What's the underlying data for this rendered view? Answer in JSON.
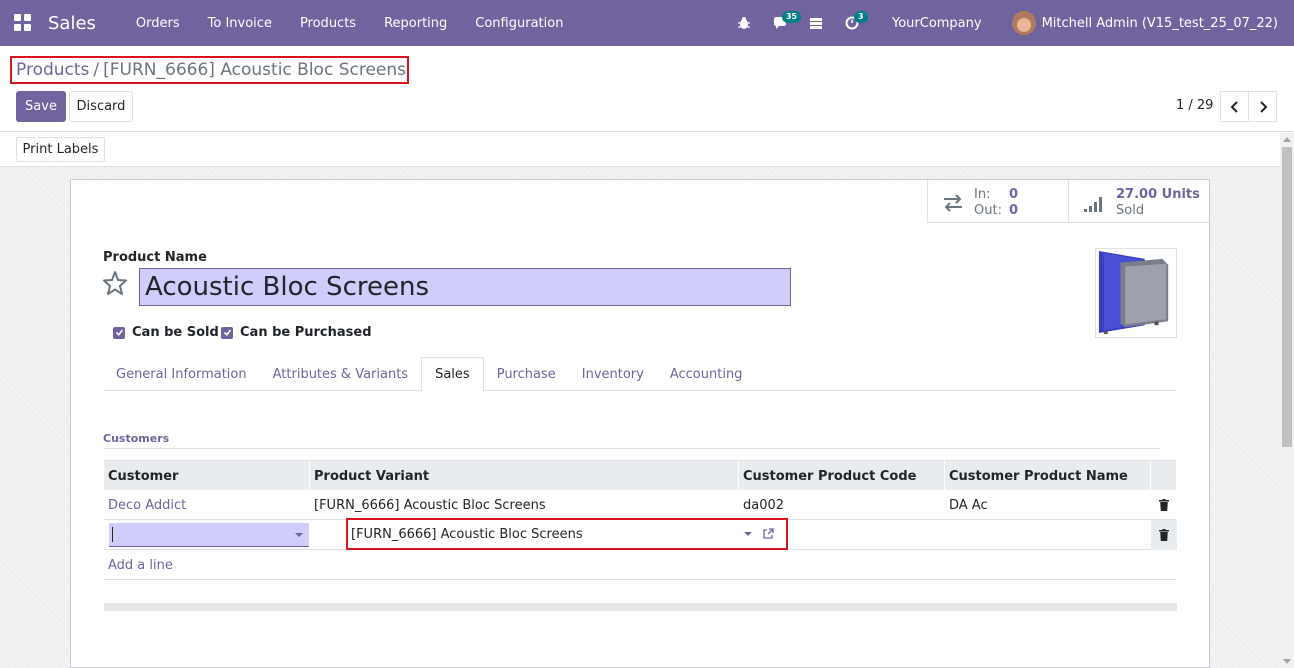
{
  "navbar": {
    "app_name": "Sales",
    "menu": [
      "Orders",
      "To Invoice",
      "Products",
      "Reporting",
      "Configuration"
    ],
    "messages_badge": "35",
    "activities_badge": "3",
    "company": "YourCompany",
    "user": "Mitchell Admin (V15_test_25_07_22)",
    "bg_color": "#71639e"
  },
  "breadcrumb": {
    "parent": "Products",
    "separator": "/",
    "current": "[FURN_6666] Acoustic Bloc Screens"
  },
  "buttons": {
    "save": "Save",
    "discard": "Discard",
    "print_labels": "Print Labels"
  },
  "pager": {
    "value": "1 / 29"
  },
  "smart_buttons": {
    "in_label": "In:",
    "in_value": "0",
    "out_label": "Out:",
    "out_value": "0",
    "sold_value": "27.00 Units",
    "sold_label": "Sold"
  },
  "form": {
    "product_name_label": "Product Name",
    "product_name": "Acoustic Bloc Screens",
    "can_be_sold": "Can be Sold",
    "can_be_purchased": "Can be Purchased"
  },
  "tabs": [
    "General Information",
    "Attributes & Variants",
    "Sales",
    "Purchase",
    "Inventory",
    "Accounting"
  ],
  "active_tab": "Sales",
  "customers": {
    "section_title": "Customers",
    "columns": [
      "Customer",
      "Product Variant",
      "Customer Product Code",
      "Customer Product Name"
    ],
    "rows": [
      {
        "customer": "Deco Addict",
        "variant": "[FURN_6666] Acoustic Bloc Screens",
        "code": "da002",
        "name": "DA Ac"
      }
    ],
    "editing_row": {
      "customer": "",
      "variant": "[FURN_6666] Acoustic Bloc Screens",
      "code": "",
      "name": ""
    },
    "add_line": "Add a line"
  },
  "colors": {
    "accent": "#71639e",
    "highlight_box": "#d9141f",
    "input_bg": "#d0cdfb"
  }
}
